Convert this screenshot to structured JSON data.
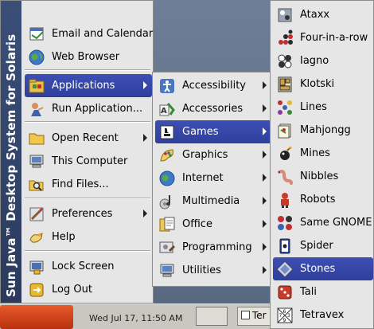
{
  "sidebar_brand": "Sun Java™ Desktop System for Solaris",
  "main_menu": {
    "items": [
      {
        "label": "Email and Calendar",
        "icon": "email-calendar-icon"
      },
      {
        "label": "Web Browser",
        "icon": "globe-icon"
      },
      {
        "label": "Applications",
        "icon": "applications-icon",
        "submenu": true,
        "selected": true
      },
      {
        "label": "Run Application...",
        "icon": "run-icon"
      },
      {
        "label": "Open Recent",
        "icon": "folder-icon",
        "submenu": true
      },
      {
        "label": "This Computer",
        "icon": "computer-icon"
      },
      {
        "label": "Find Files...",
        "icon": "find-files-icon"
      },
      {
        "label": "Preferences",
        "icon": "preferences-icon",
        "submenu": true
      },
      {
        "label": "Help",
        "icon": "help-icon"
      },
      {
        "label": "Lock Screen",
        "icon": "lock-icon"
      },
      {
        "label": "Log Out",
        "icon": "logout-icon"
      }
    ]
  },
  "applications_menu": {
    "items": [
      {
        "label": "Accessibility",
        "icon": "accessibility-icon"
      },
      {
        "label": "Accessories",
        "icon": "accessories-icon"
      },
      {
        "label": "Games",
        "icon": "games-icon",
        "selected": true
      },
      {
        "label": "Graphics",
        "icon": "graphics-icon"
      },
      {
        "label": "Internet",
        "icon": "internet-icon"
      },
      {
        "label": "Multimedia",
        "icon": "multimedia-icon"
      },
      {
        "label": "Office",
        "icon": "office-icon"
      },
      {
        "label": "Programming",
        "icon": "programming-icon"
      },
      {
        "label": "Utilities",
        "icon": "utilities-icon"
      }
    ]
  },
  "games_menu": {
    "items": [
      {
        "label": "Ataxx",
        "icon": "ataxx-icon"
      },
      {
        "label": "Four-in-a-row",
        "icon": "four-in-a-row-icon"
      },
      {
        "label": "Iagno",
        "icon": "iagno-icon"
      },
      {
        "label": "Klotski",
        "icon": "klotski-icon"
      },
      {
        "label": "Lines",
        "icon": "lines-icon"
      },
      {
        "label": "Mahjongg",
        "icon": "mahjongg-icon"
      },
      {
        "label": "Mines",
        "icon": "mines-icon"
      },
      {
        "label": "Nibbles",
        "icon": "nibbles-icon"
      },
      {
        "label": "Robots",
        "icon": "robots-icon"
      },
      {
        "label": "Same GNOME",
        "icon": "same-gnome-icon"
      },
      {
        "label": "Spider",
        "icon": "spider-icon"
      },
      {
        "label": "Stones",
        "icon": "stones-icon",
        "selected": true
      },
      {
        "label": "Tali",
        "icon": "tali-icon"
      },
      {
        "label": "Tetravex",
        "icon": "tetravex-icon"
      }
    ]
  },
  "panel": {
    "clock_text": "Wed Jul 17, 11:50 AM",
    "task_label": "Ter"
  },
  "colors": {
    "selection": "#3d4fb3",
    "menu_bg": "#e6e6e6",
    "sidebar": "#33466c",
    "launch_button": "#d24a1e"
  }
}
